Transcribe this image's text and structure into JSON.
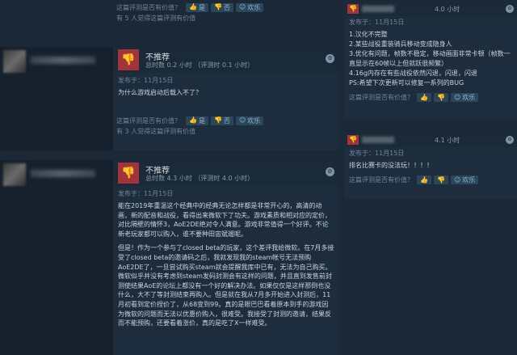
{
  "labels": {
    "helpful_question": "这篇评测是否有价值？",
    "yes": "是",
    "no": "否",
    "funny": "欢乐",
    "posted_prefix": "发布于："
  },
  "top_fragment": {
    "found_helpful": "有 5 人觉得这篇评测有价值"
  },
  "reviews": [
    {
      "recommendation": "不推荐",
      "hours": "总时数 0.2 小时 （评测时 0.1 小时）",
      "posted": "发布于：11月15日",
      "paragraphs": [
        "为什么游戏启动后载入不了？"
      ],
      "found_helpful": "有 3 人觉得这篇评测有价值"
    },
    {
      "recommendation": "不推荐",
      "hours": "总时数 4.3 小时 （评测时 4.0 小时）",
      "posted": "发布于：11月15日",
      "paragraphs": [
        "能在2019年重温这个经典中的经典无论怎样都是非常开心的，高清的动画，新的配音和战役，看得出来微软下了功夫。游戏素质和相对应的定价，对比隔壁的情怀3，AoE2DE绝对令人满意。游戏非常值得一个好评。不论新老玩家都可以购入，谁不要种田宙斌遛呢。",
        "但是！作为一个参与了closed beta的玩家，这个差评我给微软。在7月多接受了closed beta的邀请码之后，我就发现我的steam帐号无法预购AoE2DE了，一旦尝试购买steam就会提醒我库中已有，无法为自己购买。微软似乎并没有考虑到steam发码封测会有这样的问题，并且直到发售前封测使结果AoE的论坛上都没有一个好的解决办法。如果仅仅是这样那倒也没什么，大不了等封测结束再购入。但是就在我从7月多开始进入封测后，11月初看到定价捏价了，从68变到99。真的是眼巴巴看着原本到手的游戏因为微软的问题而无法以优惠价购入，很难受。我接受了封测的邀请，结果反而不能预购，还要看着涨价，真的是吃了X一样难受。"
      ]
    }
  ],
  "side_reviews": [
    {
      "hours": "4.0 小时",
      "posted": "发布于：11月15日",
      "lines": [
        "1.汉化不完整",
        "2.某些战役重装骑兵移动变成隐身人",
        "3.优化有问题，帧数不稳定，移动画面非常卡顿（帧数一直显示在60帧以上但就跃很频繁）",
        "4.16g内存在有些战役依然闪退，闪退，闪退",
        "PS:希望下次更新可以修复一系列的BUG"
      ]
    },
    {
      "hours": "4.1 小时",
      "posted": "发布于：11月15日",
      "lines": [
        "排名比赛卡的没法玩！！！！"
      ]
    }
  ],
  "colors": {
    "background": "#1b2838",
    "panel": "#1e2d3d",
    "thumbs_down": "#a3333a",
    "button": "#2a4659",
    "link_text": "#8fb4d0"
  },
  "icons": {
    "thumbs_down": "thumbs-down-icon",
    "thumbs_up": "thumbs-up-icon",
    "steam": "steam-icon",
    "funny": "funny-face-icon"
  }
}
